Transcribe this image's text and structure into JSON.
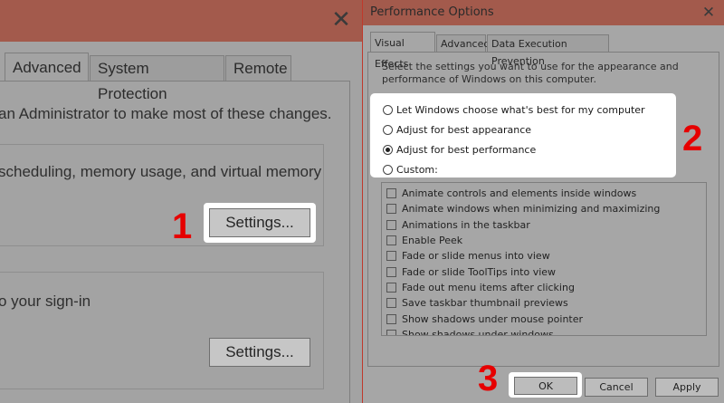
{
  "left": {
    "tabs": [
      "Advanced",
      "System Protection",
      "Remote"
    ],
    "admin_text": "an Administrator to make most of these changes.",
    "performance_text": "scheduling, memory usage, and virtual memory",
    "settings_label": "Settings...",
    "profile_text": "o your sign-in",
    "settings2_label": "Settings..."
  },
  "right": {
    "title": "Performance Options",
    "tabs": [
      "Visual Effects",
      "Advanced",
      "Data Execution Prevention"
    ],
    "description": "Select the settings you want to use for the appearance and performance of Windows on this computer.",
    "radios": [
      {
        "label": "Let Windows choose what's best for my computer",
        "checked": false
      },
      {
        "label": "Adjust for best appearance",
        "checked": false
      },
      {
        "label": "Adjust for best performance",
        "checked": true
      },
      {
        "label": "Custom:",
        "checked": false
      }
    ],
    "effects": [
      "Animate controls and elements inside windows",
      "Animate windows when minimizing and maximizing",
      "Animations in the taskbar",
      "Enable Peek",
      "Fade or slide menus into view",
      "Fade or slide ToolTips into view",
      "Fade out menu items after clicking",
      "Save taskbar thumbnail previews",
      "Show shadows under mouse pointer",
      "Show shadows under windows"
    ],
    "buttons": {
      "ok": "OK",
      "cancel": "Cancel",
      "apply": "Apply"
    }
  },
  "markers": {
    "one": "1",
    "two": "2",
    "three": "3"
  },
  "colors": {
    "marker_red": "#e60000",
    "titlebar": "#a35a4c",
    "divider": "#c0392b"
  }
}
